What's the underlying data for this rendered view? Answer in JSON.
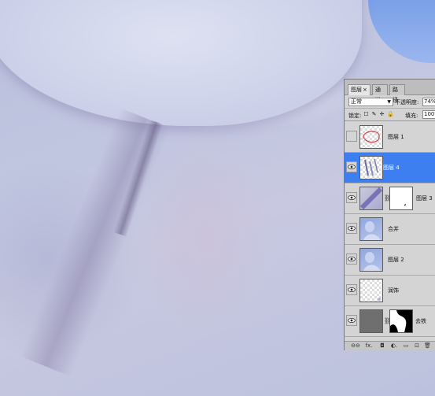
{
  "panel": {
    "tabs": [
      {
        "label": "图层",
        "close": "×",
        "active": true
      },
      {
        "label": "通道",
        "active": false
      },
      {
        "label": "路径",
        "active": false
      }
    ],
    "blend_mode": "正常",
    "opacity_label": "不透明度:",
    "opacity_value": "74%",
    "lock_label": "锁定:",
    "lock_icons": [
      "lock-transparent-icon",
      "lock-paint-icon",
      "lock-position-icon",
      "lock-all-icon"
    ],
    "fill_label": "填充:",
    "fill_value": "100%",
    "layers": [
      {
        "name": "图层 1",
        "visible": false,
        "selected": false
      },
      {
        "name": "图层 4",
        "visible": true,
        "selected": true
      },
      {
        "name": "图层 3",
        "visible": true,
        "selected": false,
        "has_mask": true
      },
      {
        "name": "合并",
        "visible": true,
        "selected": false
      },
      {
        "name": "图层 2",
        "visible": true,
        "selected": false
      },
      {
        "name": "润饰",
        "visible": true,
        "selected": false
      },
      {
        "name": "去铁",
        "visible": true,
        "selected": false,
        "has_mask": true
      }
    ],
    "footer_icons": [
      "link-layers-icon",
      "layer-style-icon",
      "add-mask-icon",
      "adjustment-layer-icon",
      "new-group-icon",
      "new-layer-icon",
      "delete-layer-icon"
    ],
    "footer_glyphs": [
      "⊖⊖",
      "fx.",
      "◘",
      "◐.",
      "▭",
      "⊡",
      "🗑"
    ],
    "selection_color": "#3d7ef0"
  }
}
